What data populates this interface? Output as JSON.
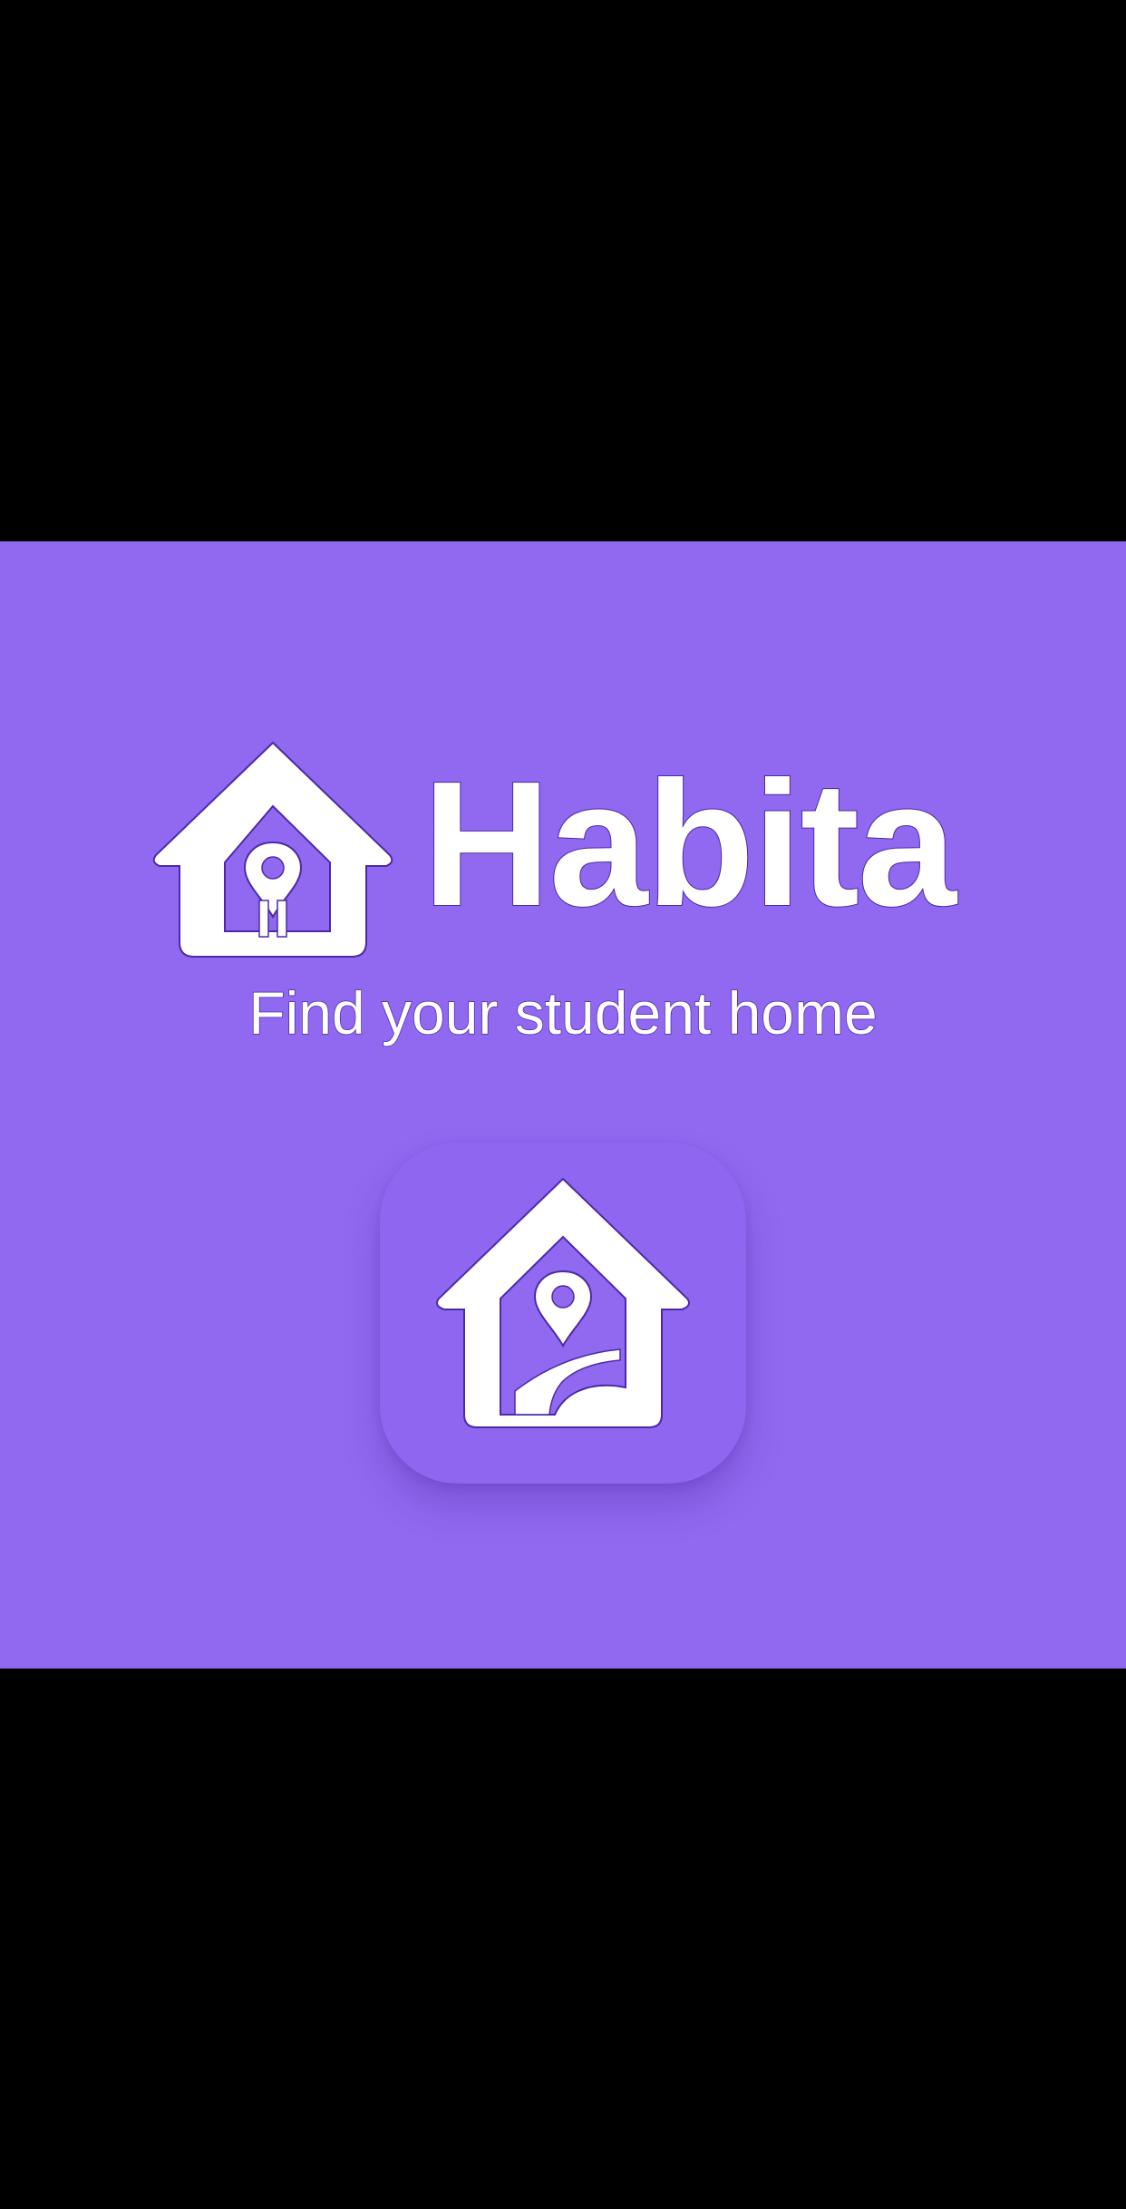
{
  "brand": {
    "name": "Habita",
    "tagline": "Find your student home",
    "logo_icon": "house-location-pin-icon",
    "app_icon": "house-location-pin-path-icon"
  },
  "colors": {
    "background": "#9069f0",
    "letterbox": "#000000",
    "foreground": "#ffffff",
    "outline": "#4b2aa8"
  }
}
